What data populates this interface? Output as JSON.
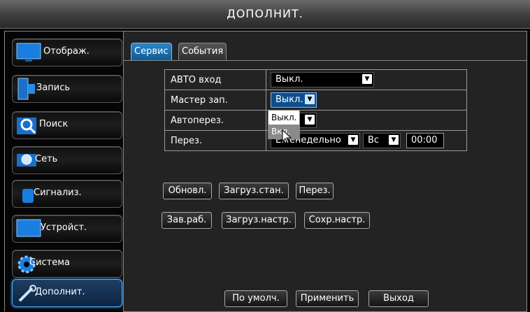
{
  "window": {
    "title": "ДОПОЛНИТ."
  },
  "sidebar": {
    "items": [
      {
        "label": "Отображ.",
        "icon": "monitor-icon"
      },
      {
        "label": "Запись",
        "icon": "film-icon"
      },
      {
        "label": "Поиск",
        "icon": "magnifier-icon"
      },
      {
        "label": "Сеть",
        "icon": "network-icon"
      },
      {
        "label": "Сигнализ.",
        "icon": "alarm-icon"
      },
      {
        "label": "Устройст.",
        "icon": "device-icon"
      },
      {
        "label": "Система",
        "icon": "gear-icon"
      },
      {
        "label": "Дополнит.",
        "icon": "wrench-icon"
      }
    ],
    "active": "Дополнит."
  },
  "tabs": [
    {
      "label": "Сервис"
    },
    {
      "label": "События"
    }
  ],
  "settings": [
    {
      "label": "АВТО вход",
      "value": "Выкл."
    },
    {
      "label": "Мастер зап.",
      "value": "Выкл."
    },
    {
      "label": "Автоперез.",
      "value": ""
    },
    {
      "label": "Перез.",
      "value": "Еженедельно",
      "day": "Вс",
      "time": "00:00"
    }
  ],
  "dropdown_options": [
    "Выкл.",
    "Вкл."
  ],
  "buttons": {
    "update": "Обновл.",
    "load_default": "Загруз.стан.",
    "reboot": "Перез.",
    "shutdown": "Зав.раб.",
    "load_config": "Загруз.настр.",
    "save_config": "Сохр.настр.",
    "default": "По умолч.",
    "apply": "Применить",
    "exit": "Выход"
  },
  "colors": {
    "accent": "#2a86c8",
    "highlight": "#4fb0ff",
    "background": "#232323"
  }
}
